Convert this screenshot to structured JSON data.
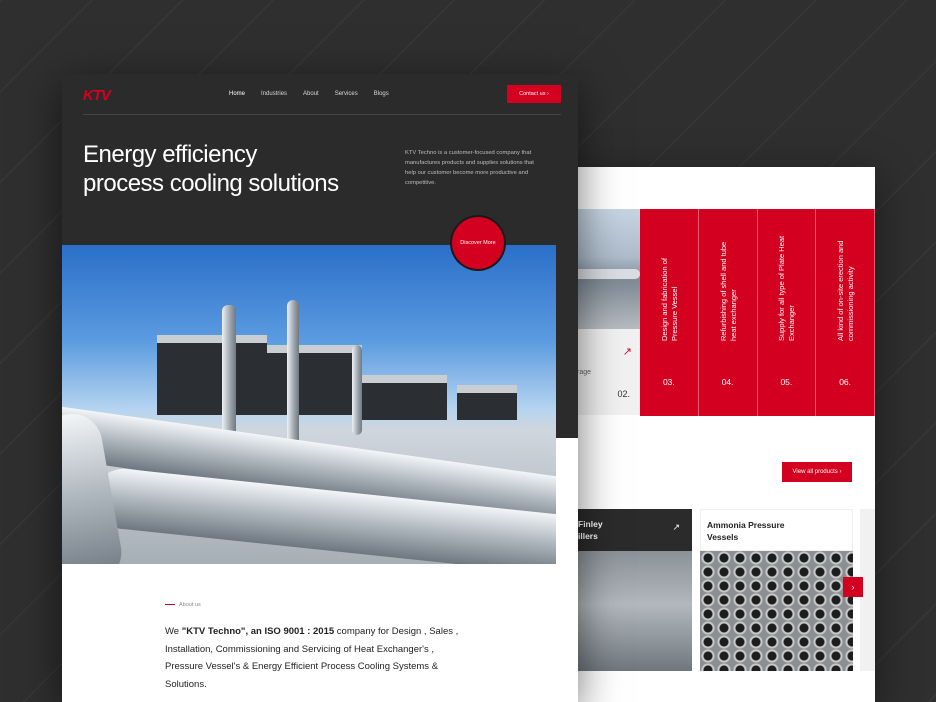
{
  "brand": {
    "logo_text": "KTV",
    "accent": "#d4001f",
    "dark": "#2b2b2b"
  },
  "nav": {
    "items": [
      "Home",
      "Industries",
      "About",
      "Services",
      "Blogs"
    ],
    "contact_label": "Contact us",
    "contact_icon": "chevron-right-icon"
  },
  "hero": {
    "title_line1": "Energy efficiency",
    "title_line2": "process cooling solutions",
    "intro": "KTV Techno is a customer-focused company that manufactures products and supplies solutions that help our customer become more productive and competitive.",
    "discover_label": "Discover More"
  },
  "about": {
    "label": "About us",
    "prefix": "We ",
    "bold": "\"KTV Techno\", an ISO 9001 : 2015",
    "suffix": " company  for  Design , Sales , Installation, Commissioning and Servicing of Heat Exchanger's , Pressure Vessel's & Energy Efficient Process Cooling Systems & Solutions."
  },
  "services": {
    "card2_fragment": "rage",
    "card2_number": "02.",
    "columns": [
      {
        "text": "Design and fabrication of Pressure Vessel",
        "number": "03."
      },
      {
        "text": "Refurbishing of shell and tube heat exchanger",
        "number": "04."
      },
      {
        "text": "Supply for all type of Plate Heat Exchanger",
        "number": "05."
      },
      {
        "text": "All kind of on-site erection and commissioning activity",
        "number": "06."
      }
    ]
  },
  "products": {
    "view_all_label": "View all products",
    "items": [
      {
        "title_line1": "Finley",
        "title_line2": "illers"
      },
      {
        "title_line1": "Ammonia Pressure",
        "title_line2": "Vessels"
      }
    ]
  }
}
